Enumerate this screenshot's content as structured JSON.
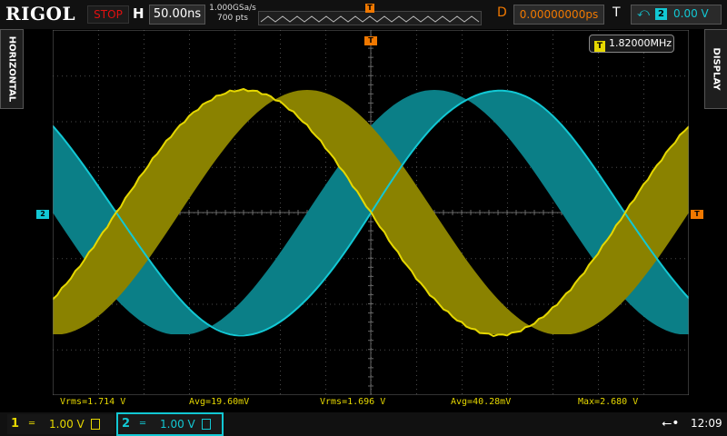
{
  "header": {
    "logo": "RIGOL",
    "run_state": "STOP",
    "timebase_label": "H",
    "timebase_value": "50.00ns",
    "sample_rate": "1.000GSa/s",
    "memory_depth": "700 pts",
    "delay_label": "D",
    "delay_value": "0.00000000ps",
    "trigger_label": "T",
    "trigger_source": "2",
    "trigger_level": "0.00 V"
  },
  "side_tabs": {
    "left": "HORIZONTAL",
    "right": "DISPLAY"
  },
  "frequency_counter": {
    "value": "1.82000MHz"
  },
  "markers": {
    "trigger_top": "T",
    "ch2_ground": "2",
    "trigger_level": "T"
  },
  "measurements": [
    {
      "label": "Vrms=1.714 V"
    },
    {
      "label": "Avg=19.60mV"
    },
    {
      "label": "Vrms=1.696 V"
    },
    {
      "label": "Avg=40.28mV"
    },
    {
      "label": "Max=2.680 V"
    }
  ],
  "channels": [
    {
      "number": "1",
      "scale": "1.00 V",
      "color": "#e6d800"
    },
    {
      "number": "2",
      "scale": "1.00 V",
      "color": "#12c8d4"
    }
  ],
  "status": {
    "clock": "12:09",
    "usb_icon": "usb-icon"
  },
  "colors": {
    "ch1": "#e6d800",
    "ch2": "#12c8d4",
    "trigger": "#f07800",
    "ch1_persist": "#8a8200",
    "ch2_persist": "#0b7f87"
  }
}
